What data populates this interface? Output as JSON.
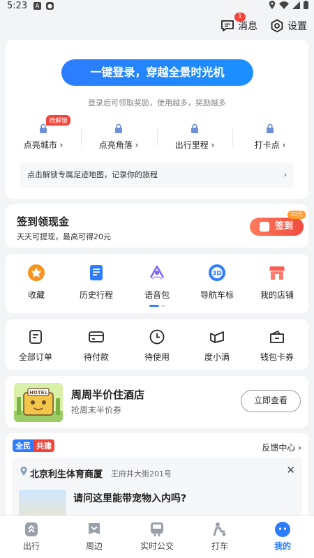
{
  "status_bar": {
    "time": "5:23"
  },
  "top_nav": {
    "messages_label": "消息",
    "messages_badge": "1",
    "settings_label": "设置"
  },
  "login_card": {
    "login_button": "一键登录，穿越全景时光机",
    "hint": "登录后可领取奖励，使用越多，奖励越多",
    "pending_tag": "待解锁",
    "unlock_items": [
      {
        "label": "点亮城市 ›"
      },
      {
        "label": "点亮角落 ›"
      },
      {
        "label": "出行里程 ›"
      },
      {
        "label": "打卡点 ›"
      }
    ],
    "footprint_text": "点击解锁专属足迹地图，记录你的旅程",
    "footprint_arrow": "›"
  },
  "signin_card": {
    "title": "签到领现金",
    "subtitle": "天天可提现，最高可得20元",
    "button_label": "签到",
    "tag": "20元"
  },
  "quick_actions": [
    {
      "label": "收藏",
      "icon": "star-icon",
      "color": "#f7931e"
    },
    {
      "label": "历史行程",
      "icon": "history-doc-icon",
      "color": "#2d7cff"
    },
    {
      "label": "语音包",
      "icon": "voice-icon",
      "color": "#7b61ff"
    },
    {
      "label": "导航车标",
      "icon": "nav-3d-icon",
      "color": "#2d7cff"
    },
    {
      "label": "我的店铺",
      "icon": "store-icon",
      "color": "#ff5a4f"
    }
  ],
  "orders": [
    {
      "label": "全部订单",
      "icon": "orders-icon"
    },
    {
      "label": "待付款",
      "icon": "card-icon"
    },
    {
      "label": "待使用",
      "icon": "clock-icon"
    },
    {
      "label": "度小满",
      "icon": "duxiaoman-icon"
    },
    {
      "label": "钱包卡券",
      "icon": "wallet-icon"
    }
  ],
  "hotel_promo": {
    "title": "周周半价住酒店",
    "subtitle": "抢周末半价券",
    "button_label": "立即查看",
    "image_sign": "HOTEL"
  },
  "qa_card": {
    "tag_a": "全民",
    "tag_b": "共建",
    "feedback_label": "反馈中心 ›",
    "poi_name": "北京利生体育商厦",
    "poi_address": "王府井大街201号",
    "close_label": "✕",
    "question": "请问这里能带宠物入内吗?"
  },
  "bottom_tabs": [
    {
      "label": "出行",
      "icon": "travel-icon",
      "active": false
    },
    {
      "label": "周边",
      "icon": "nearby-icon",
      "active": false
    },
    {
      "label": "实时公交",
      "icon": "bus-icon",
      "active": false
    },
    {
      "label": "打车",
      "icon": "taxi-icon",
      "active": false
    },
    {
      "label": "我的",
      "icon": "profile-icon",
      "active": true
    }
  ]
}
